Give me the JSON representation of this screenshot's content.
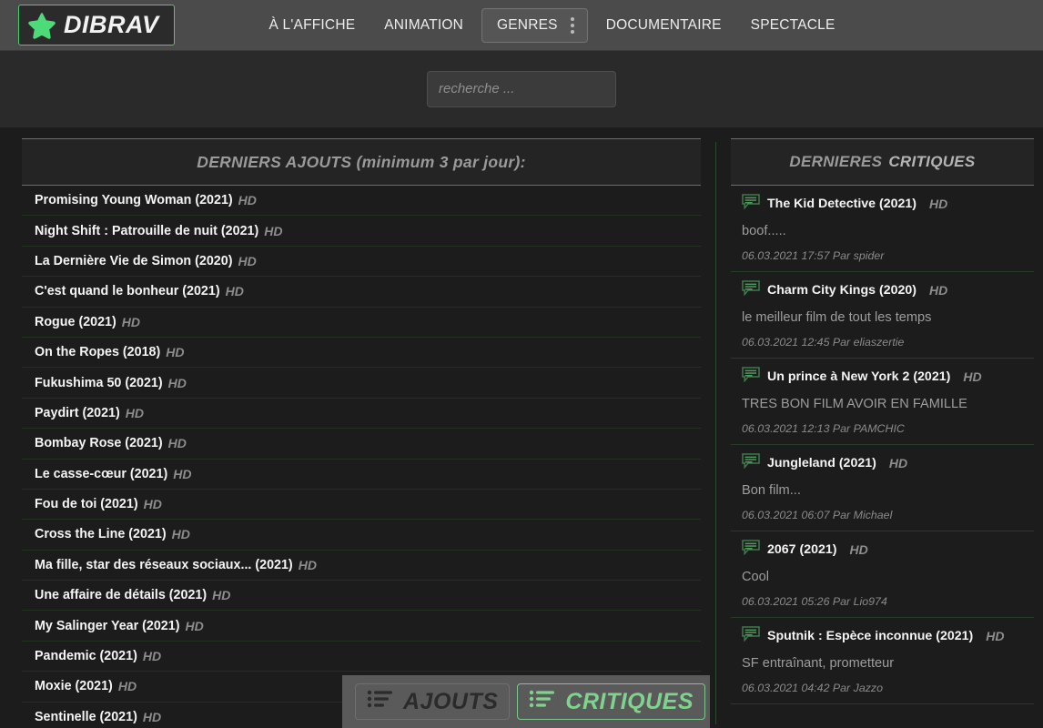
{
  "brand": {
    "name": "DIBRAV",
    "star_icon": "star-icon",
    "accent_green": "#49cc6c"
  },
  "nav": {
    "items": [
      {
        "label": "À L'AFFICHE",
        "boxed": false,
        "has_menu": false
      },
      {
        "label": "ANIMATION",
        "boxed": false,
        "has_menu": false
      },
      {
        "label": "GENRES",
        "boxed": true,
        "has_menu": true
      },
      {
        "label": "DOCUMENTAIRE",
        "boxed": false,
        "has_menu": false
      },
      {
        "label": "SPECTACLE",
        "boxed": false,
        "has_menu": false
      }
    ]
  },
  "search": {
    "placeholder": "recherche ...",
    "value": ""
  },
  "additions_panel": {
    "header": "DERNIERS AJOUTS (minimum 3 par jour):",
    "items": [
      {
        "title": "Promising Young Woman (2021)",
        "quality": "HD"
      },
      {
        "title": "Night Shift : Patrouille de nuit (2021)",
        "quality": "HD"
      },
      {
        "title": "La Dernière Vie de Simon (2020)",
        "quality": "HD"
      },
      {
        "title": "C'est quand le bonheur (2021)",
        "quality": "HD"
      },
      {
        "title": "Rogue (2021)",
        "quality": "HD"
      },
      {
        "title": "On the Ropes (2018)",
        "quality": "HD"
      },
      {
        "title": "Fukushima 50 (2021)",
        "quality": "HD"
      },
      {
        "title": "Paydirt (2021)",
        "quality": "HD"
      },
      {
        "title": "Bombay Rose (2021)",
        "quality": "HD"
      },
      {
        "title": "Le casse-cœur (2021)",
        "quality": "HD"
      },
      {
        "title": "Fou de toi (2021)",
        "quality": "HD"
      },
      {
        "title": "Cross the Line (2021)",
        "quality": "HD"
      },
      {
        "title": "Ma fille, star des réseaux sociaux... (2021)",
        "quality": "HD"
      },
      {
        "title": "Une affaire de détails (2021)",
        "quality": "HD"
      },
      {
        "title": "My Salinger Year (2021)",
        "quality": "HD"
      },
      {
        "title": "Pandemic (2021)",
        "quality": "HD"
      },
      {
        "title": "Moxie (2021)",
        "quality": "HD"
      },
      {
        "title": "Sentinelle (2021)",
        "quality": "HD"
      }
    ]
  },
  "reviews_panel": {
    "header_part1": "DERNIERES",
    "header_part2": "CRITIQUES",
    "items": [
      {
        "title": "The Kid Detective (2021)",
        "quality": "HD",
        "comment": "boof.....",
        "meta": "06.03.2021 17:57 Par spider"
      },
      {
        "title": "Charm City Kings (2020)",
        "quality": "HD",
        "comment": "le meilleur film de tout les temps",
        "meta": "06.03.2021 12:45 Par eliaszertie"
      },
      {
        "title": "Un prince à New York 2 (2021)",
        "quality": "HD",
        "comment": "TRES BON FILM AVOIR EN FAMILLE",
        "meta": "06.03.2021 12:13 Par PAMCHIC"
      },
      {
        "title": "Jungleland (2021)",
        "quality": "HD",
        "comment": "Bon film...",
        "meta": "06.03.2021 06:07 Par Michael"
      },
      {
        "title": "2067 (2021)",
        "quality": "HD",
        "comment": "Cool",
        "meta": "06.03.2021 05:26 Par Lio974"
      },
      {
        "title": "Sputnik : Espèce inconnue (2021)",
        "quality": "HD",
        "comment": "SF entraînant, prometteur",
        "meta": "06.03.2021 04:42 Par Jazzo"
      }
    ]
  },
  "bottom_tabs": {
    "ajouts_label": "AJOUTS",
    "critiques_label": "CRITIQUES",
    "active": "CRITIQUES"
  }
}
